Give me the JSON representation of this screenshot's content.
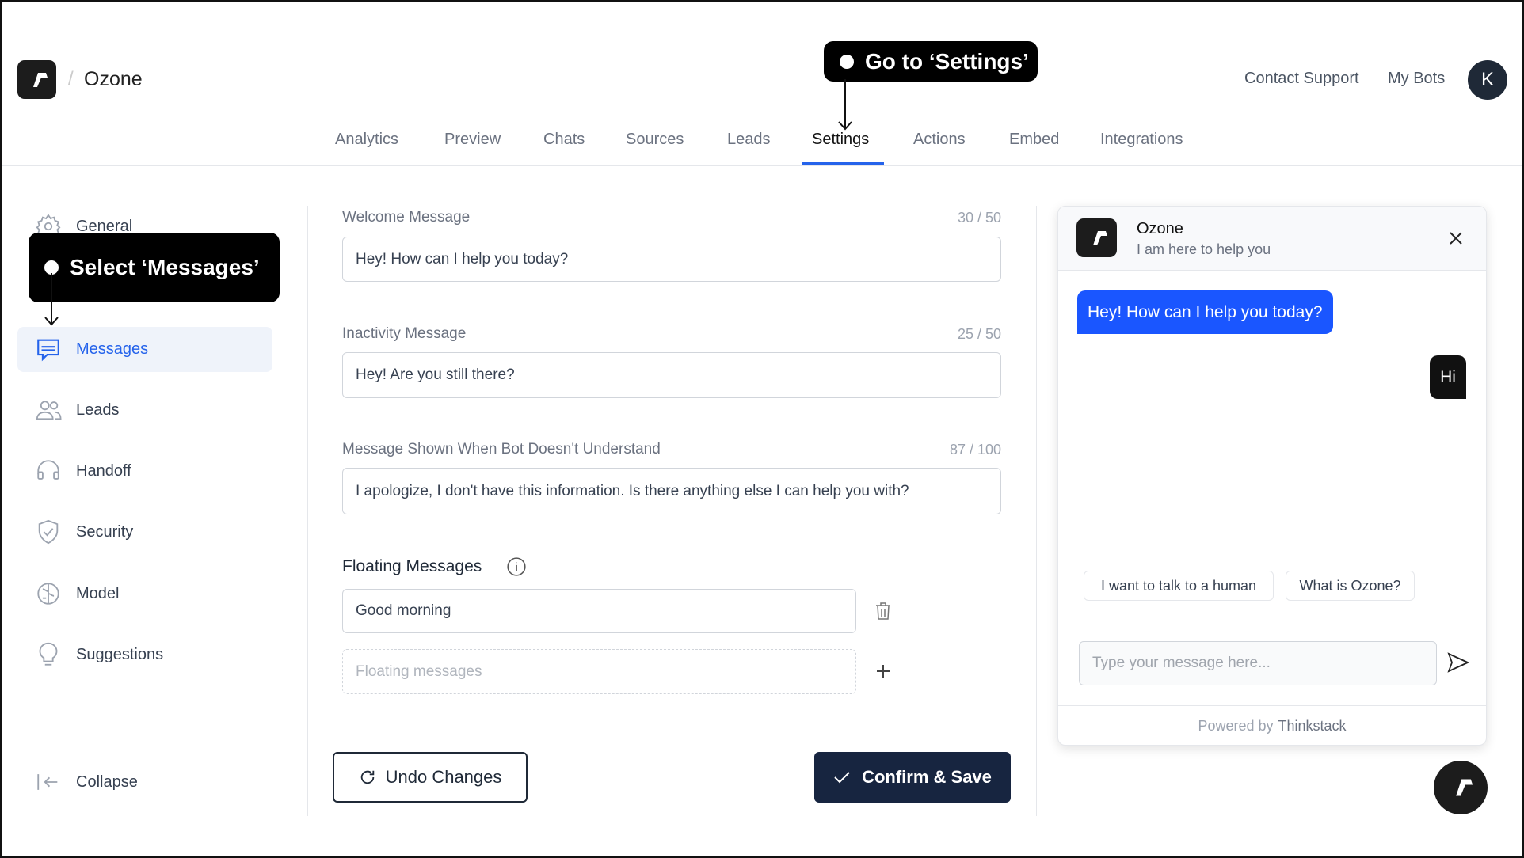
{
  "header": {
    "bot_name": "Ozone",
    "separator": "/",
    "contact_support": "Contact Support",
    "my_bots": "My Bots",
    "avatar_initial": "K"
  },
  "tabs": [
    {
      "label": "Analytics"
    },
    {
      "label": "Preview"
    },
    {
      "label": "Chats"
    },
    {
      "label": "Sources"
    },
    {
      "label": "Leads"
    },
    {
      "label": "Settings",
      "active": true
    },
    {
      "label": "Actions"
    },
    {
      "label": "Embed"
    },
    {
      "label": "Integrations"
    }
  ],
  "callouts": {
    "settings": "Go to ‘Settings’",
    "messages": "Select ‘Messages’"
  },
  "sidebar": {
    "items": [
      {
        "label": "General",
        "icon": "gear-icon"
      },
      {
        "label": "Messages",
        "icon": "message-icon",
        "active": true
      },
      {
        "label": "Leads",
        "icon": "users-icon"
      },
      {
        "label": "Handoff",
        "icon": "headset-icon"
      },
      {
        "label": "Security",
        "icon": "shield-icon"
      },
      {
        "label": "Model",
        "icon": "brain-icon"
      },
      {
        "label": "Suggestions",
        "icon": "lightbulb-icon"
      }
    ],
    "collapse": "Collapse"
  },
  "form": {
    "welcome": {
      "label": "Welcome Message",
      "count": "30 / 50",
      "value": "Hey! How can I help you today?"
    },
    "inactivity": {
      "label": "Inactivity Message",
      "count": "25 / 50",
      "value": "Hey! Are you still there?"
    },
    "fallback": {
      "label": "Message Shown When Bot Doesn't Understand",
      "count": "87 / 100",
      "value": "I apologize, I don't have this information. Is there anything else I can help you with?"
    },
    "floating": {
      "label": "Floating Messages",
      "items": [
        "Good morning"
      ],
      "placeholder": "Floating messages"
    }
  },
  "actions": {
    "undo": "Undo Changes",
    "confirm": "Confirm & Save"
  },
  "chat": {
    "title": "Ozone",
    "subtitle": "I am here to help you",
    "bot_message": "Hey! How can I help you today?",
    "user_message": "Hi",
    "suggestions": [
      "I want to talk to a human",
      "What is Ozone?"
    ],
    "input_placeholder": "Type your message here...",
    "powered_by": "Powered by",
    "brand": "Thinkstack"
  },
  "colors": {
    "accent": "#2563eb",
    "bubble": "#1a56ff",
    "confirm_bg": "#172540",
    "active_bg": "#eff3fa"
  }
}
